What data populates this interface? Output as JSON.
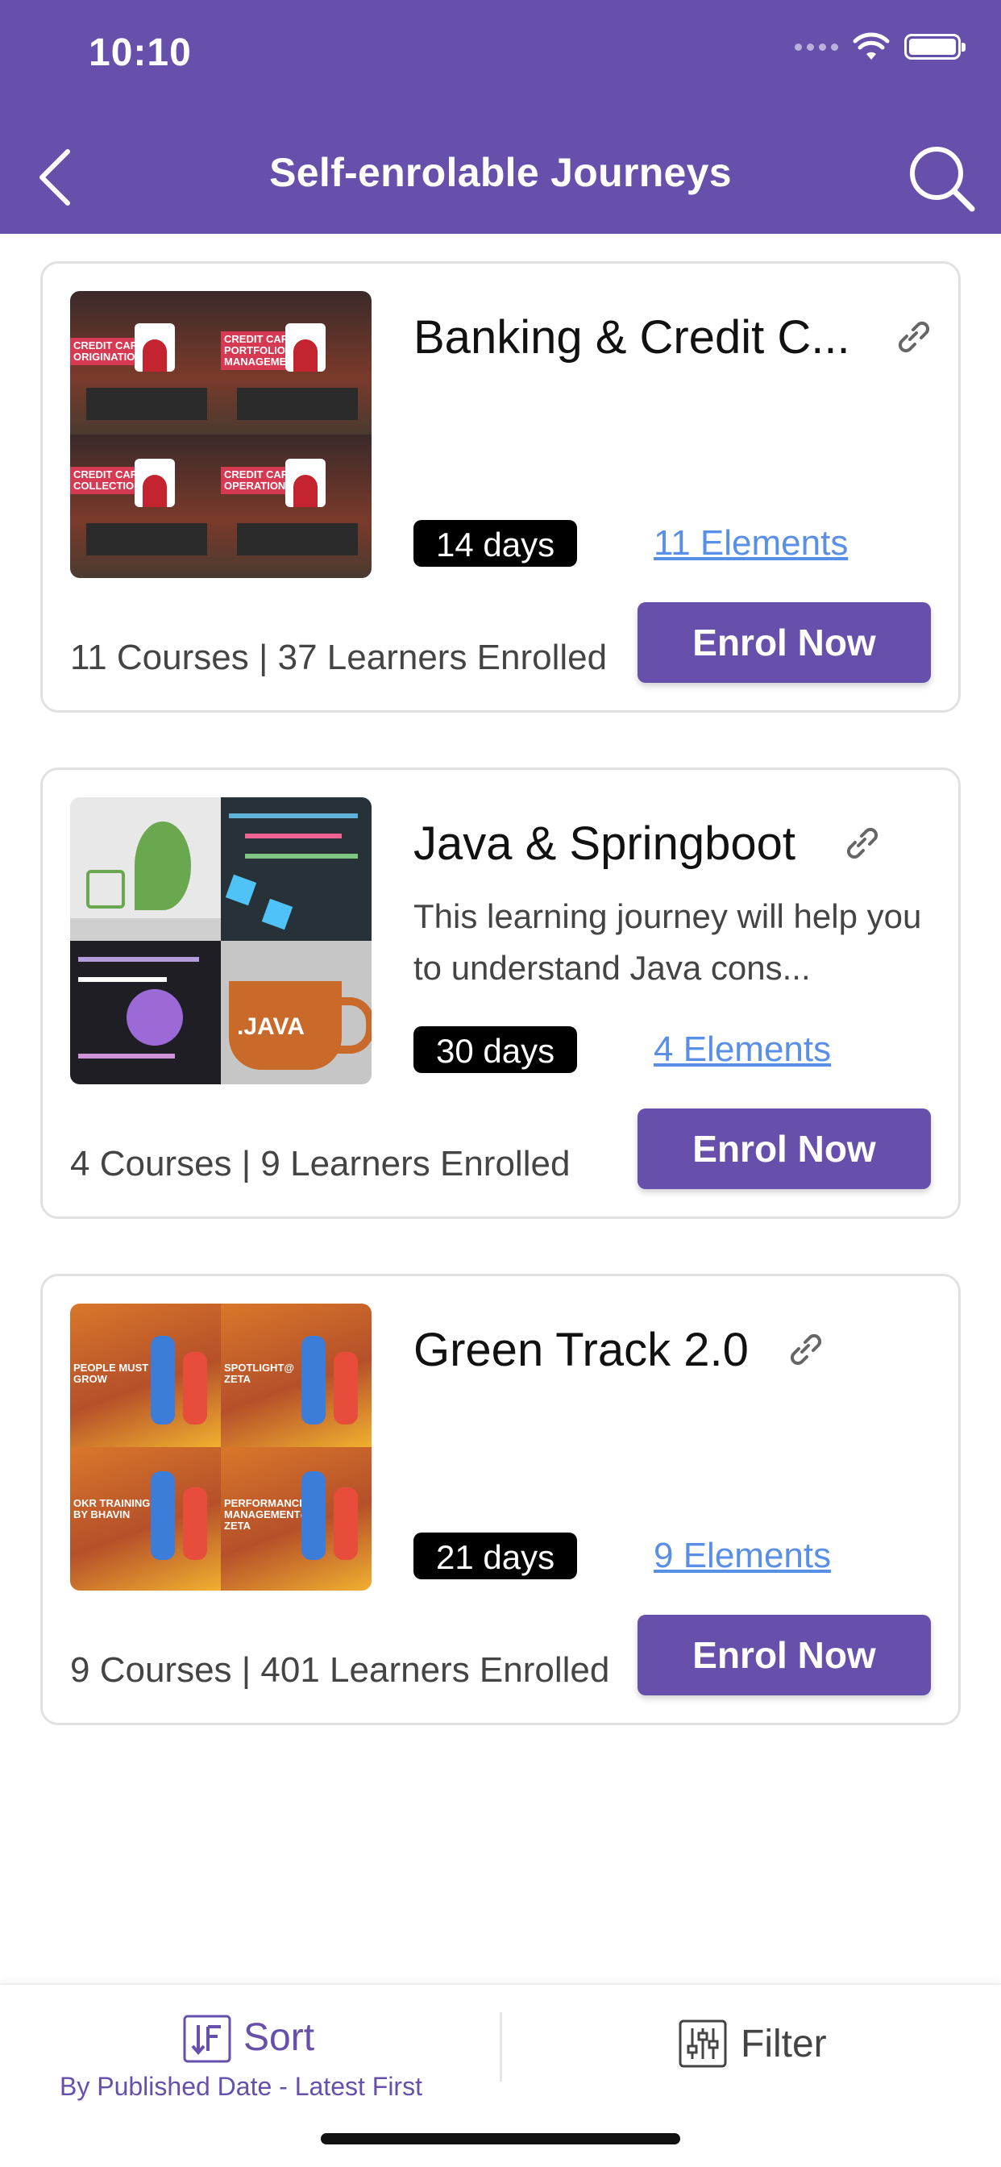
{
  "status_bar": {
    "time": "10:10"
  },
  "header": {
    "title": "Self-enrolable Journeys",
    "background": "#6650ac"
  },
  "journeys": [
    {
      "title": "Banking & Credit C...",
      "description": "",
      "days": "14 days",
      "elements": "11 Elements",
      "stats": "11 Courses   |   37 Learners Enrolled",
      "enrol": "Enrol Now",
      "thumb_labels": [
        "CREDIT CARDS ORIGINATION",
        "CREDIT CARDS PORTFOLIO MANAGEMENT",
        "CREDIT CARDS COLLECTIONS",
        "CREDIT CARDS OPERATIONS"
      ]
    },
    {
      "title": "Java & Springboot",
      "description": "This learning journey will help you to understand Java cons...",
      "days": "30 days",
      "elements": "4 Elements",
      "stats": "4 Courses   |   9 Learners Enrolled",
      "enrol": "Enrol Now",
      "thumb_labels": [
        ".JAVA"
      ]
    },
    {
      "title": "Green Track 2.0",
      "description": "",
      "days": "21 days",
      "elements": "9 Elements",
      "stats": "9 Courses   |   401 Learners Enrolled",
      "enrol": "Enrol Now",
      "thumb_labels": [
        "PEOPLE MUST GROW",
        "SPOTLIGHT@ ZETA",
        "OKR TRAINING BY BHAVIN",
        "PERFORMANCE MANAGEMENT@ ZETA"
      ]
    }
  ],
  "bottom_bar": {
    "sort_label": "Sort",
    "sort_sub": "By Published Date - Latest First",
    "filter_label": "Filter"
  },
  "colors": {
    "accent": "#6650ac",
    "link": "#5a8fe8",
    "badge": "#000000"
  }
}
